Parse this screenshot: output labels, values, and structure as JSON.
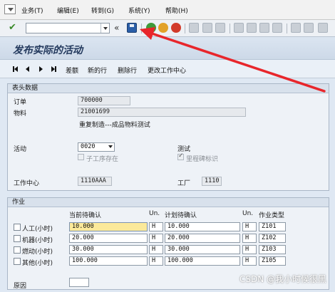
{
  "menu": {
    "items": [
      "业务(T)",
      "编辑(E)",
      "转到(G)",
      "系统(Y)",
      "帮助(H)"
    ]
  },
  "toolbar": {
    "enter_icon": "check-icon",
    "command_field_value": "",
    "collapse_glyph": "«",
    "save_icon": "save-icon"
  },
  "title": "发布实际的活动",
  "app_toolbar": {
    "buttons": [
      "差额",
      "新的行",
      "删除行",
      "更改工作中心"
    ]
  },
  "header": {
    "section_title": "表头数据",
    "order_label": "订单",
    "order_value": "700000",
    "material_label": "物料",
    "material_value": "21001699",
    "material_desc": "重复制造---成品物料测试",
    "activity_label": "活动",
    "activity_value": "0020",
    "activity_desc": "测试",
    "sub_op_label": "子工序存在",
    "milestone_label": "里程碑标识",
    "milestone_checked": true,
    "work_center_label": "工作中心",
    "work_center_value": "1110AAA",
    "plant_label": "工厂",
    "plant_value": "1110"
  },
  "ops": {
    "section_title": "作业",
    "col_current": "当前待确认",
    "col_unit": "Un.",
    "col_planned": "计划待确认",
    "col_unit2": "Un.",
    "col_type": "作业类型",
    "rows": [
      {
        "label": "人工(小时)",
        "current": "10.000",
        "unit": "H",
        "planned": "10.000",
        "unit2": "H",
        "type": "Z101"
      },
      {
        "label": "机器(小时)",
        "current": "20.000",
        "unit": "H",
        "planned": "20.000",
        "unit2": "H",
        "type": "Z102"
      },
      {
        "label": "燃动(小时)",
        "current": "30.000",
        "unit": "H",
        "planned": "30.000",
        "unit2": "H",
        "type": "Z103"
      },
      {
        "label": "其他(小时)",
        "current": "100.000",
        "unit": "H",
        "planned": "100.000",
        "unit2": "H",
        "type": "Z105"
      }
    ],
    "reason_label": "原因",
    "reason_value": ""
  },
  "watermark": "CSDN @我小时候很黑",
  "colors": {
    "arrow": "#e8262b",
    "focus_field": "#fbe99a",
    "title_text": "#243a5e"
  }
}
